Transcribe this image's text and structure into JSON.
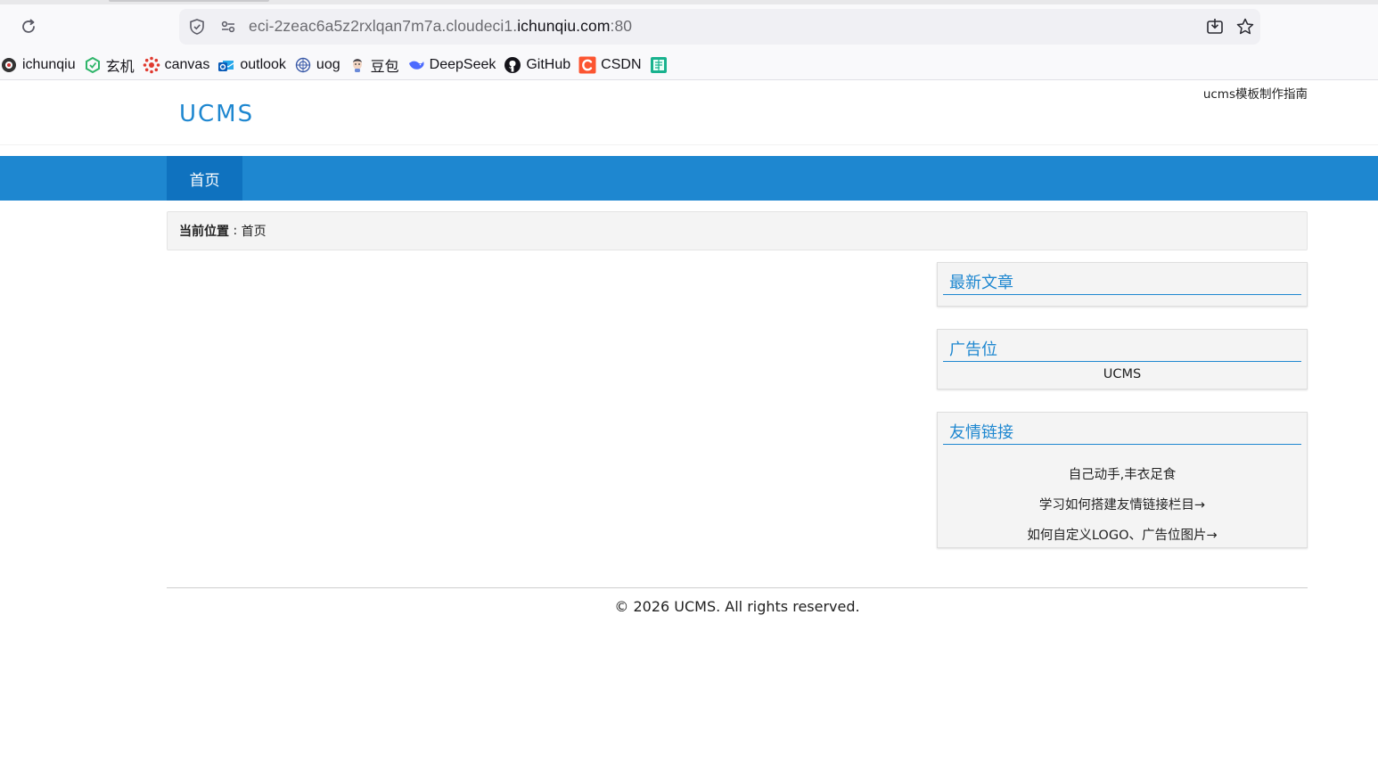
{
  "browser": {
    "url_prefix": "eci-2zeac6a5z2rxlqan7m7a.cloudeci1.",
    "url_domain": "ichunqiu.com",
    "url_suffix": ":80",
    "icons": {
      "reload": "reload-icon",
      "shield": "shield-icon",
      "permissions": "permissions-icon",
      "download": "save-page-icon",
      "bookmark_star": "star-icon"
    },
    "bookmarks": [
      {
        "label": "ichunqiu",
        "icon": "ichunqiu-icon",
        "color": "#333333"
      },
      {
        "label": "玄机",
        "icon": "xuanji-icon",
        "color": "#2fb56a"
      },
      {
        "label": "canvas",
        "icon": "canvas-icon",
        "color": "#e03a2f"
      },
      {
        "label": "outlook",
        "icon": "outlook-icon",
        "color": "#1a73d9"
      },
      {
        "label": "uog",
        "icon": "uog-icon",
        "color": "#3a5aa8"
      },
      {
        "label": "豆包",
        "icon": "doubao-icon",
        "color": "#6a8ad8"
      },
      {
        "label": "DeepSeek",
        "icon": "deepseek-icon",
        "color": "#4d6bfe"
      },
      {
        "label": "GitHub",
        "icon": "github-icon",
        "color": "#15141a"
      },
      {
        "label": "CSDN",
        "icon": "csdn-icon",
        "color": "#fc5531"
      },
      {
        "label": "",
        "icon": "notes-icon",
        "color": "#19b28e"
      }
    ]
  },
  "site": {
    "logo": "UCMS",
    "guide_link": "ucms模板制作指南",
    "nav": [
      {
        "label": "首页"
      }
    ],
    "breadcrumb": {
      "label": "当前位置",
      "separator": " : ",
      "current": "首页"
    },
    "sidebar": {
      "latest": {
        "title": "最新文章"
      },
      "ad": {
        "title": "广告位",
        "content": "UCMS"
      },
      "links": {
        "title": "友情链接",
        "items": [
          "自己动手,丰衣足食",
          "学习如何搭建友情链接栏目→",
          "如何自定义LOGO、广告位图片→"
        ]
      }
    },
    "footer": "© 2026 UCMS. All rights reserved.",
    "colors": {
      "brand_blue": "#1e87d0",
      "nav_active": "#0f72bf",
      "panel_bg": "#f4f4f4"
    }
  }
}
